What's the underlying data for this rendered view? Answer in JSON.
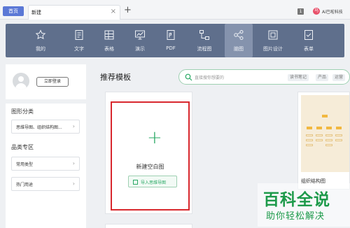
{
  "tabbar": {
    "home_tab": "首页",
    "doc_tab": "新建",
    "close_glyph": "×",
    "add_glyph": "+",
    "badge": "1",
    "user_initial": "乌",
    "user_name": "Ai巴啦科技"
  },
  "toolbar": {
    "items": [
      {
        "label": "我的",
        "icon": "star-icon"
      },
      {
        "label": "文字",
        "icon": "text-doc-icon"
      },
      {
        "label": "表格",
        "icon": "table-icon"
      },
      {
        "label": "演示",
        "icon": "presentation-icon"
      },
      {
        "label": "PDF",
        "icon": "pdf-icon"
      },
      {
        "label": "流程图",
        "icon": "flowchart-icon"
      },
      {
        "label": "脑图",
        "icon": "mindmap-icon",
        "active": true
      },
      {
        "label": "图片设计",
        "icon": "image-design-icon"
      },
      {
        "label": "表单",
        "icon": "form-icon"
      }
    ]
  },
  "sidebar": {
    "login_button": "立即登录",
    "category_title": "图形分类",
    "category_items": [
      {
        "label": "思维导图、组织结构图..."
      }
    ],
    "special_title": "品类专区",
    "special_items": [
      {
        "label": "常用类型"
      },
      {
        "label": "热门用途"
      }
    ],
    "chevron": "›"
  },
  "main": {
    "title": "推荐模板",
    "search": {
      "placeholder": "直接搜你想要的",
      "tags": [
        "读书笔记",
        "产品",
        "运营"
      ]
    },
    "new_card": {
      "plus": "+",
      "name": "新建空白图",
      "import_label": "导入思维导图"
    },
    "org_card": {
      "name": "组织结构图"
    }
  },
  "watermark": {
    "main": "百科全说",
    "sub": "助你轻松解决"
  },
  "colors": {
    "toolbar_bg": "#5f6f8c",
    "home_tab": "#5b78d6",
    "accent_green": "#2aa965",
    "highlight_red": "#d8282e"
  }
}
